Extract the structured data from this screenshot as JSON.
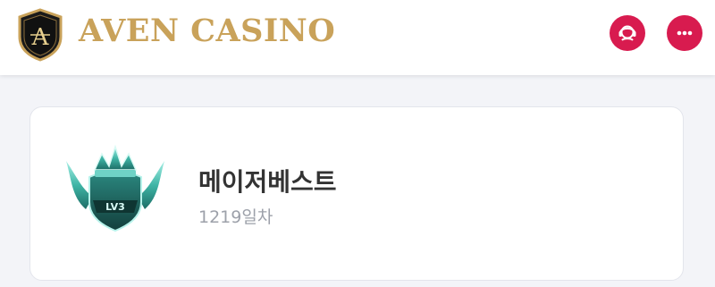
{
  "header": {
    "brand": "AVEN CASINO",
    "logo_letter": "A",
    "support_icon": "headset-agent-icon",
    "chat_icon": "chat-bubble-icon",
    "accent_color": "#d81b4f",
    "brand_color": "#c9a25a"
  },
  "profile": {
    "username": "메이저베스트",
    "days": "1219일차",
    "badge_level": "LV3"
  }
}
